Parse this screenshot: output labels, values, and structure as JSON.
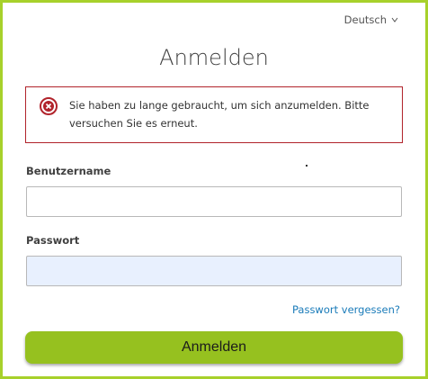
{
  "language": {
    "selected": "Deutsch"
  },
  "page": {
    "title": "Anmelden"
  },
  "alert": {
    "icon": "error-circle-x-icon",
    "color": "#b1232b",
    "message": "Sie haben zu lange gebraucht, um sich anzumelden. Bitte versuchen Sie es erneut."
  },
  "form": {
    "username_label": "Benutzername",
    "username_value": "",
    "password_label": "Passwort",
    "password_value": "",
    "forgot_link": "Passwort vergessen?",
    "submit_label": "Anmelden"
  },
  "colors": {
    "accent": "#96c11f",
    "frame": "#a7d12b",
    "link": "#1a7bb9",
    "autofill": "#e8f0fe"
  }
}
